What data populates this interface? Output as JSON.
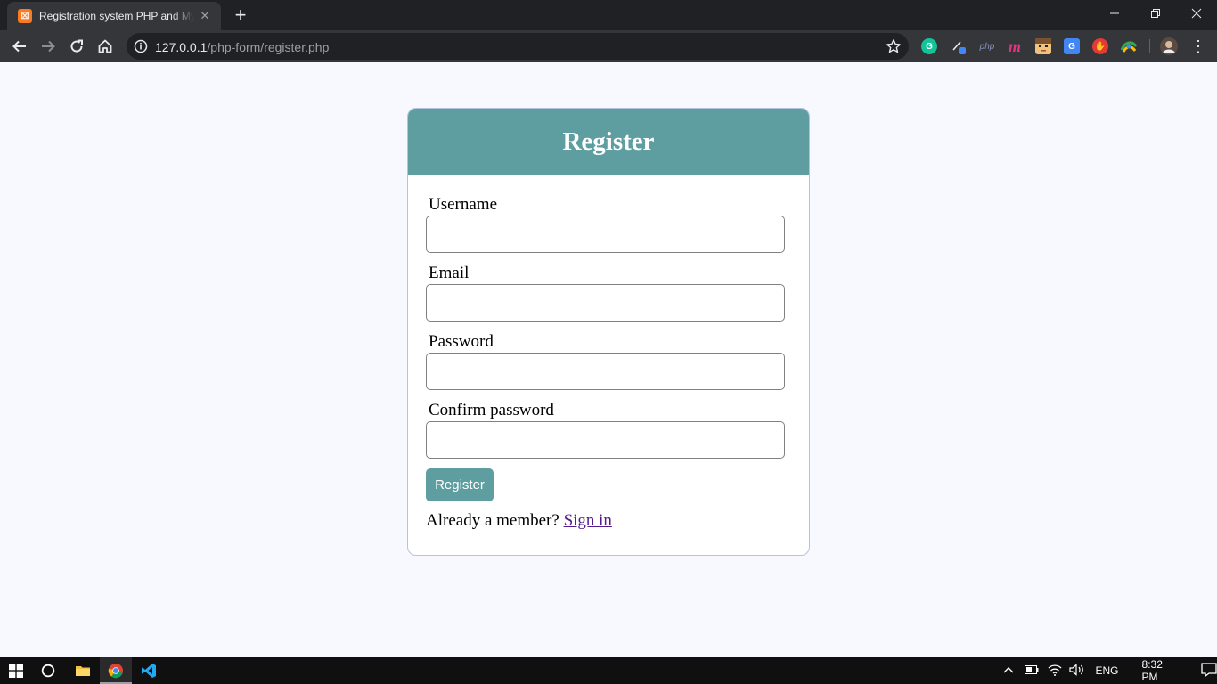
{
  "browser": {
    "tab_title": "Registration system PHP and MySQL",
    "tab_favicon_glyph": "☒",
    "new_tab": "+",
    "url_host": "127.0.0.1",
    "url_path": "/php-form/register.php",
    "extensions": [
      "grammarly-icon",
      "pen-icon",
      "php-icon",
      "monday-icon",
      "face-icon",
      "translate-icon",
      "hand-stop-icon",
      "photo-icon",
      "profile-avatar"
    ]
  },
  "page": {
    "heading": "Register",
    "fields": [
      {
        "label": "Username",
        "value": ""
      },
      {
        "label": "Email",
        "value": ""
      },
      {
        "label": "Password",
        "value": ""
      },
      {
        "label": "Confirm password",
        "value": ""
      }
    ],
    "submit_label": "Register",
    "member_text": "Already a member?",
    "signin_link": "Sign in",
    "colors": {
      "accent": "#5f9ea0",
      "card_border": "#b0c4de",
      "background": "#f8f8ff",
      "link_visited": "#551a8b"
    }
  },
  "taskbar": {
    "language": "ENG",
    "time": "8:32 PM"
  }
}
